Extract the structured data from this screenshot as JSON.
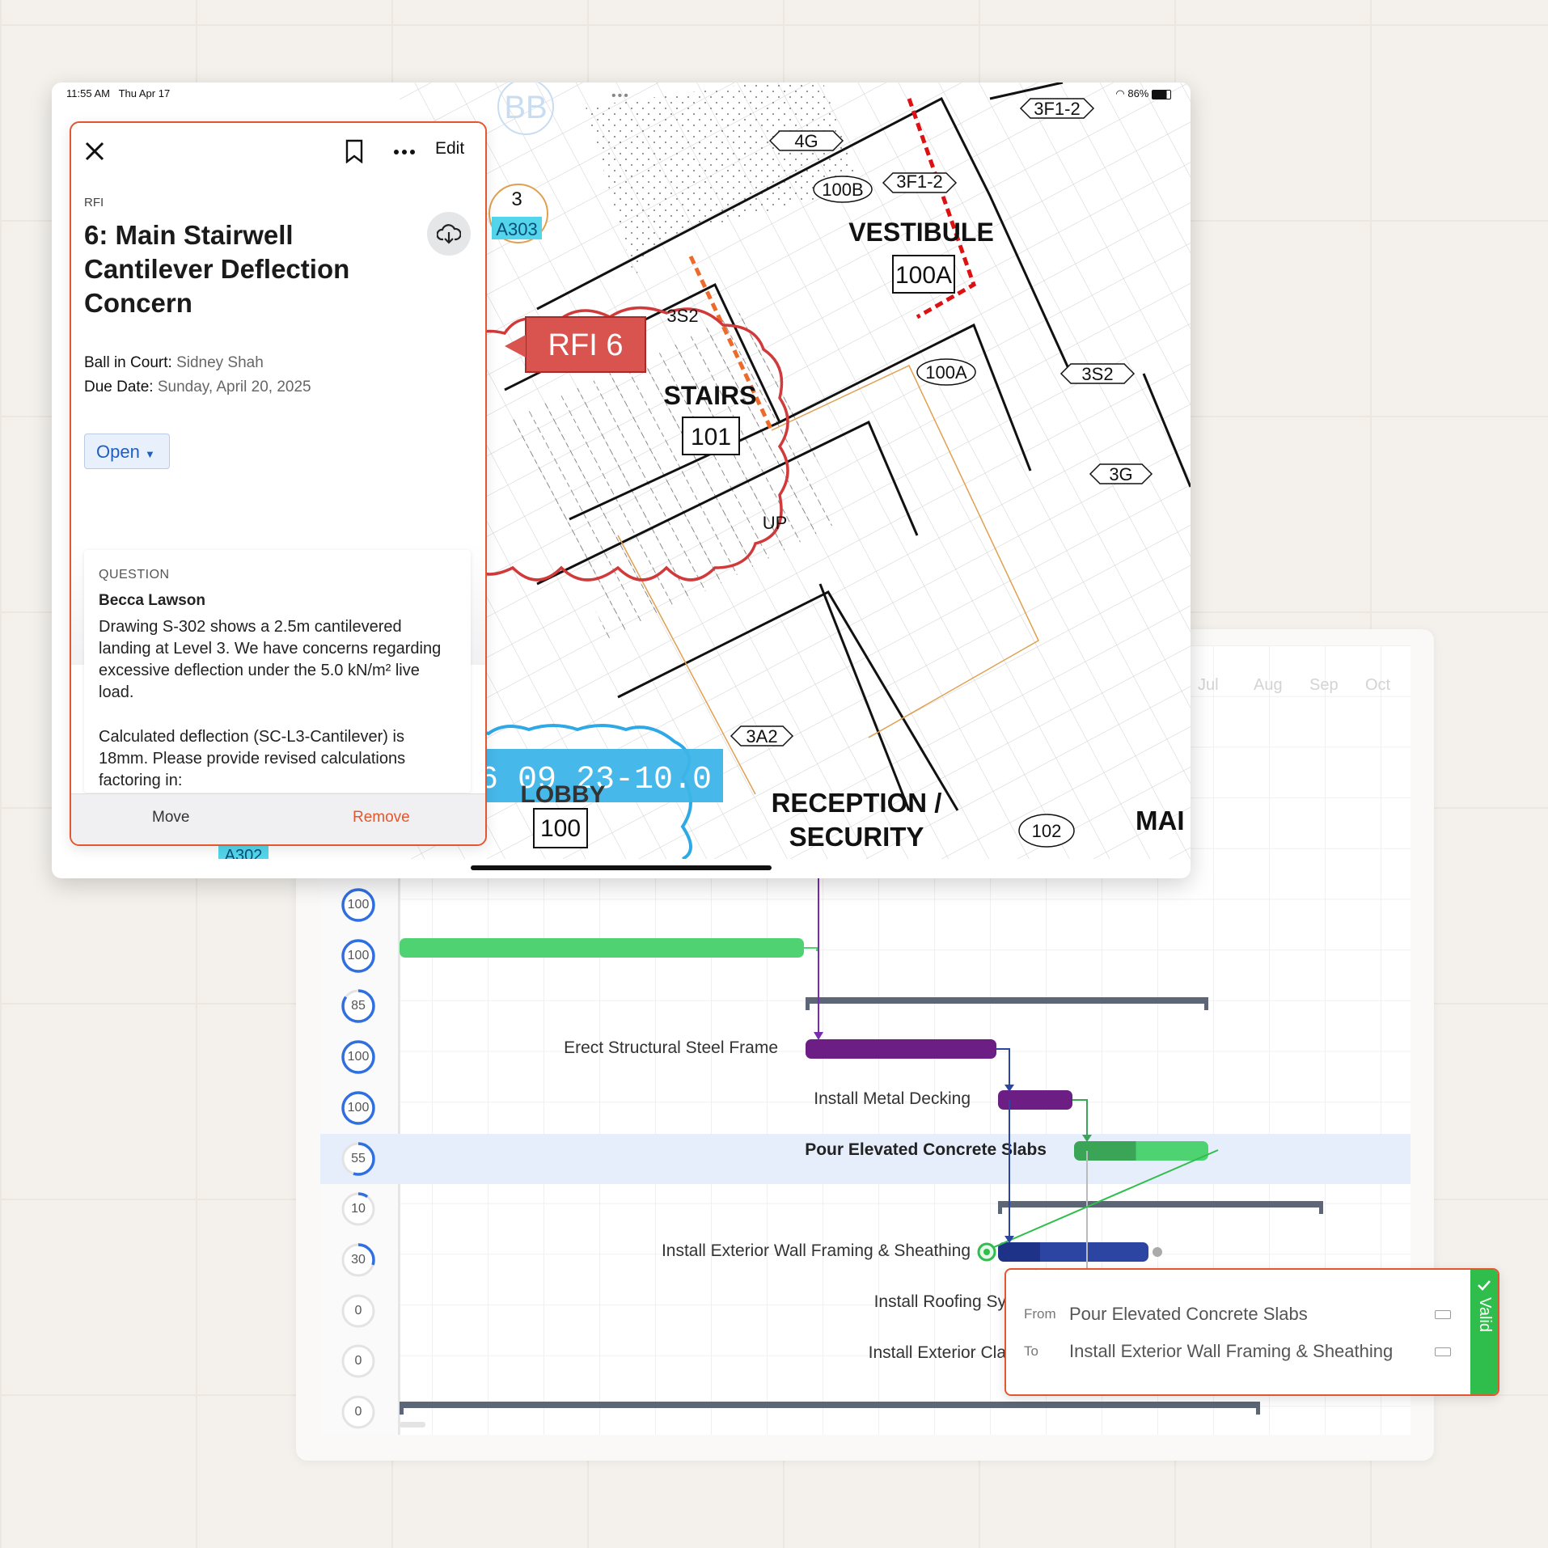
{
  "status_bar": {
    "time": "11:55 AM",
    "date": "Thu Apr 17",
    "battery": "86%"
  },
  "rfi": {
    "type_label": "RFI",
    "title": "6: Main Stairwell Cantilever Deflection Concern",
    "ball_in_court_label": "Ball in Court:",
    "ball_in_court": "Sidney Shah",
    "due_date_label": "Due Date:",
    "due_date": "Sunday, April 20, 2025",
    "status": "Open",
    "edit_label": "Edit",
    "question_label": "QUESTION",
    "author": "Becca Lawson",
    "question_p1": "Drawing S-302 shows a 2.5m cantilevered landing at Level 3. We have concerns regarding excessive deflection under the 5.0 kN/m² live load.",
    "question_p2": "Calculated deflection (SC-L3-Cantilever) is 18mm. Please provide revised calculations factoring in:",
    "move_label": "Move",
    "remove_label": "Remove"
  },
  "drawing": {
    "rooms": [
      {
        "name": "VESTIBULE",
        "number": "100A"
      },
      {
        "name": "STAIRS",
        "number": "101"
      },
      {
        "name": "RECEPTION / SECURITY",
        "number": ""
      },
      {
        "name": "LOBBY",
        "number": "100"
      },
      {
        "name": "MAI",
        "number": ""
      }
    ],
    "tags": [
      "4G",
      "100B",
      "3F1-2",
      "3F1-2",
      "3S2",
      "3S2",
      "100A",
      "3G",
      "3A2",
      "102",
      "A303",
      "3",
      "BB",
      "A302",
      "UP"
    ],
    "rfi_marker": "RFI 6",
    "spec_marker": "S 26 09 23-10.0"
  },
  "gantt": {
    "months": [
      "Jul",
      "Aug",
      "Sep",
      "Oct"
    ],
    "rows": [
      {
        "pct": 100,
        "task": ""
      },
      {
        "pct": 100,
        "task": ""
      },
      {
        "pct": 85,
        "task": ""
      },
      {
        "pct": 100,
        "task": "Erect Structural Steel Frame"
      },
      {
        "pct": 100,
        "task": "Install Metal Decking"
      },
      {
        "pct": 55,
        "task": "Pour Elevated Concrete Slabs"
      },
      {
        "pct": 10,
        "task": ""
      },
      {
        "pct": 30,
        "task": "Install Exterior Wall Framing & Sheathing"
      },
      {
        "pct": 0,
        "task": "Install Roofing Sy"
      },
      {
        "pct": 0,
        "task": "Install Exterior Cla"
      },
      {
        "pct": 0,
        "task": ""
      }
    ],
    "colors": {
      "green": "#4fd272",
      "purple": "#6c1e85",
      "blue": "#2c45a3",
      "summary": "#5c6677",
      "ring": "#2f6fdf"
    }
  },
  "tooltip": {
    "from_label": "From",
    "from_value": "Pour Elevated Concrete Slabs",
    "to_label": "To",
    "to_value": "Install Exterior Wall Framing & Sheathing",
    "status": "Valid"
  }
}
